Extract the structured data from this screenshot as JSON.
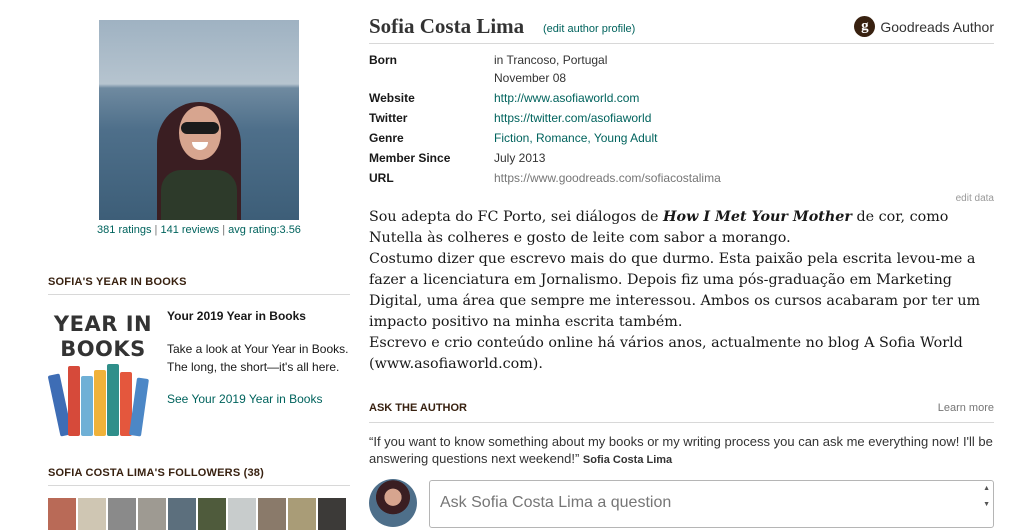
{
  "left": {
    "stats": {
      "ratings": "381 ratings",
      "reviews": "141 reviews",
      "avg": "avg rating:3.56"
    },
    "year_in_books": {
      "header": "SOFIA'S YEAR IN BOOKS",
      "cover_text": "YEAR IN BOOKS",
      "title": "Your 2019 Year in Books",
      "description": "Take a look at Your Year in Books. The long, the short—it's all here.",
      "link": "See Your 2019 Year in Books"
    },
    "followers": {
      "header": "SOFIA COSTA LIMA'S FOLLOWERS (38)",
      "avatar_colors": [
        "#b96a57",
        "#cfc6b3",
        "#8a8a8a",
        "#9e9a92",
        "#5c6f7d",
        "#4f5b3c",
        "#c8cccc",
        "#8a7a6a",
        "#a99c77",
        "#3c3a38"
      ]
    }
  },
  "author": {
    "name": "Sofia Costa Lima",
    "edit_profile": "(edit author profile)",
    "badge_letter": "g",
    "badge_label": "Goodreads Author"
  },
  "details": {
    "born_label": "Born",
    "born_place": "in Trancoso, Portugal",
    "born_date": "November 08",
    "website_label": "Website",
    "website": "http://www.asofiaworld.com",
    "twitter_label": "Twitter",
    "twitter": "https://twitter.com/asofiaworld",
    "genre_label": "Genre",
    "genre": "Fiction, Romance, Young Adult",
    "member_label": "Member Since",
    "member": "July 2013",
    "url_label": "URL",
    "url": "https://www.goodreads.com/sofiacostalima",
    "edit_data": "edit data"
  },
  "bio": {
    "p1_start": "Sou adepta do FC Porto, sei diálogos de ",
    "p1_em": "How I Met Your Mother",
    "p1_end": " de cor, como Nutella às colheres e gosto de leite com sabor a morango.",
    "p2": "Costumo dizer que escrevo mais do que durmo. Esta paixão pela escrita levou-me a fazer a licenciatura em Jornalismo. Depois fiz uma pós-graduação em Marketing Digital, uma área que sempre me interessou. Ambos os cursos acabaram por ter um impacto positivo na minha escrita também.",
    "p3_start": "Escrevo e crio conteúdo online há vários anos, actualmente no blog A Sofia World (",
    "p3_link": "www.asofiaworld.com",
    "p3_end": ")."
  },
  "ask": {
    "header": "ASK THE AUTHOR",
    "learn_more": "Learn more",
    "quote": "“If you want to know something about my books or my writing process you can ask me everything now! I'll be answering questions next weekend!”",
    "quote_author": "Sofia Costa Lima",
    "placeholder": "Ask Sofia Costa Lima a question"
  }
}
